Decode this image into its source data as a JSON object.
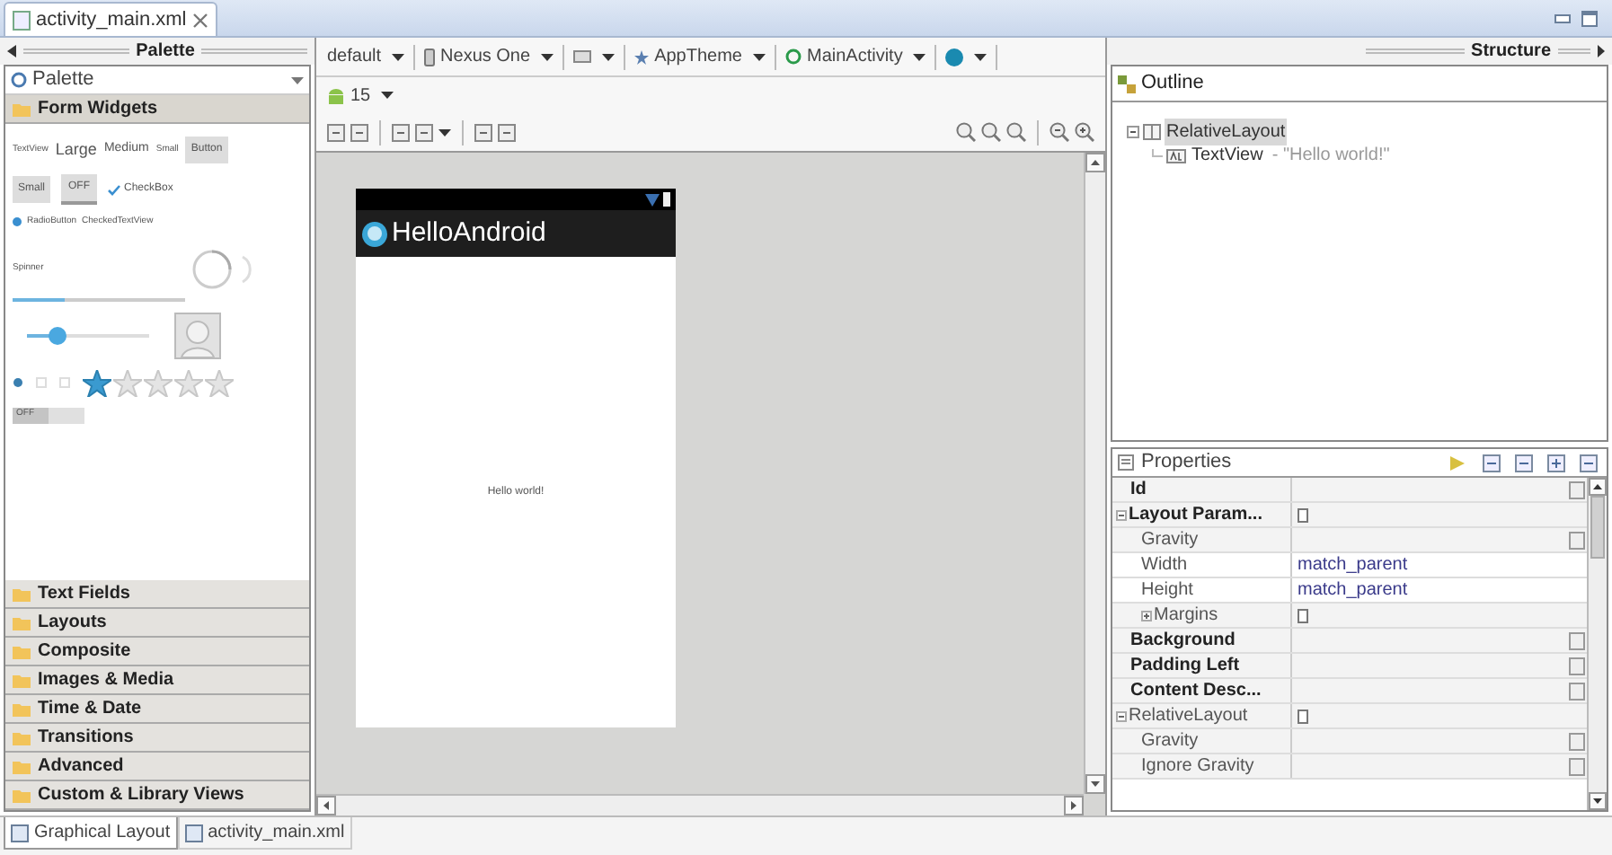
{
  "editor_tab": {
    "title": "activity_main.xml"
  },
  "palette": {
    "header": "Palette",
    "selector": "Palette",
    "categories": [
      {
        "label": "Form Widgets",
        "expanded": true
      },
      {
        "label": "Text Fields",
        "expanded": false
      },
      {
        "label": "Layouts",
        "expanded": false
      },
      {
        "label": "Composite",
        "expanded": false
      },
      {
        "label": "Images & Media",
        "expanded": false
      },
      {
        "label": "Time & Date",
        "expanded": false
      },
      {
        "label": "Transitions",
        "expanded": false
      },
      {
        "label": "Advanced",
        "expanded": false
      },
      {
        "label": "Custom & Library Views",
        "expanded": false
      }
    ],
    "form_widgets": {
      "text_sizes": [
        "TextView",
        "Large",
        "Medium",
        "Small"
      ],
      "button": "Button",
      "small_button": "Small",
      "toggle": "OFF",
      "checkbox": {
        "label": "CheckBox",
        "checked": true
      },
      "radio": {
        "label": "RadioButton",
        "selected": true
      },
      "checked_text": "CheckedTextView",
      "spinner": "Spinner",
      "progress": {
        "level": 0.3
      },
      "seekbar": {
        "level": 0.25
      },
      "radio_group": [
        {
          "selected": true
        },
        {
          "selected": false
        },
        {
          "selected": false
        }
      ],
      "rating": {
        "stars": 1
      },
      "switch": {
        "label": "OFF",
        "checked": false
      }
    }
  },
  "toolbar": {
    "config": "default",
    "device": "Nexus One",
    "theme": "AppTheme",
    "activity": "MainActivity",
    "api": "15"
  },
  "preview": {
    "app_title": "HelloAndroid",
    "text": "Hello world!"
  },
  "structure": {
    "header": "Structure",
    "outline_tab": "Outline",
    "tree": [
      {
        "label": "RelativeLayout",
        "selected": true,
        "expanded": true,
        "children": [
          {
            "label": "TextView",
            "detail": "- \"Hello world!\"",
            "selected": false
          }
        ]
      }
    ]
  },
  "properties": {
    "title": "Properties",
    "rows": [
      {
        "kind": "field",
        "name": "Id",
        "bold": true,
        "editor_button": true
      },
      {
        "kind": "group",
        "name": "Layout Param...",
        "bold": true,
        "expanded": true,
        "children": [
          {
            "kind": "field",
            "name": "Gravity",
            "bold": false,
            "editor_button": true
          },
          {
            "kind": "field",
            "name": "Width",
            "bold": false,
            "value": "match_parent",
            "editor_button": false
          },
          {
            "kind": "field",
            "name": "Height",
            "bold": false,
            "value": "match_parent",
            "editor_button": false
          },
          {
            "kind": "group",
            "name": "Margins",
            "bold": false,
            "expanded": false
          }
        ]
      },
      {
        "kind": "field",
        "name": "Background",
        "bold": true,
        "editor_button": true
      },
      {
        "kind": "field",
        "name": "Padding Left",
        "bold": true,
        "editor_button": true
      },
      {
        "kind": "field",
        "name": "Content Desc...",
        "bold": true,
        "editor_button": true
      },
      {
        "kind": "group",
        "name": "RelativeLayout",
        "bold": false,
        "expanded": true,
        "children": [
          {
            "kind": "field",
            "name": "Gravity",
            "bold": false,
            "editor_button": true
          },
          {
            "kind": "field",
            "name": "Ignore Gravity",
            "bold": false,
            "editor_button": true
          }
        ]
      }
    ]
  },
  "bottom_tabs": [
    {
      "label": "Graphical Layout",
      "selected": true
    },
    {
      "label": "activity_main.xml",
      "selected": false
    }
  ]
}
